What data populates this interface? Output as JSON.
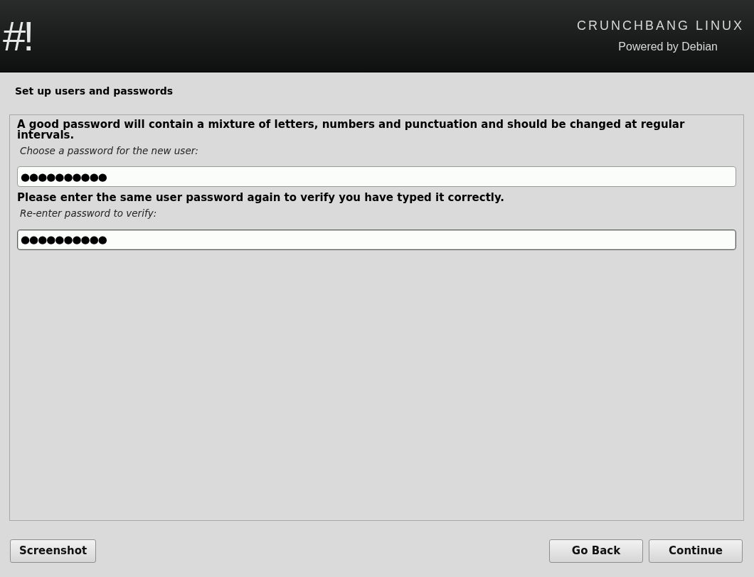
{
  "header": {
    "logo": "#!",
    "title": "CRUNCHBANG LINUX",
    "subtitle": "Powered by Debian"
  },
  "page_title": "Set up users and passwords",
  "questions": [
    {
      "description": "A good password will contain a mixture of letters, numbers and punctuation and should be changed at regular intervals.",
      "prompt": "Choose a password for the new user:",
      "value": "●●●●●●●●●●",
      "focused": false
    },
    {
      "description": "Please enter the same user password again to verify you have typed it correctly.",
      "prompt": "Re-enter password to verify:",
      "value": "●●●●●●●●●●",
      "focused": true
    }
  ],
  "buttons_left": [
    "Screenshot"
  ],
  "buttons_right": [
    "Go Back",
    "Continue"
  ]
}
